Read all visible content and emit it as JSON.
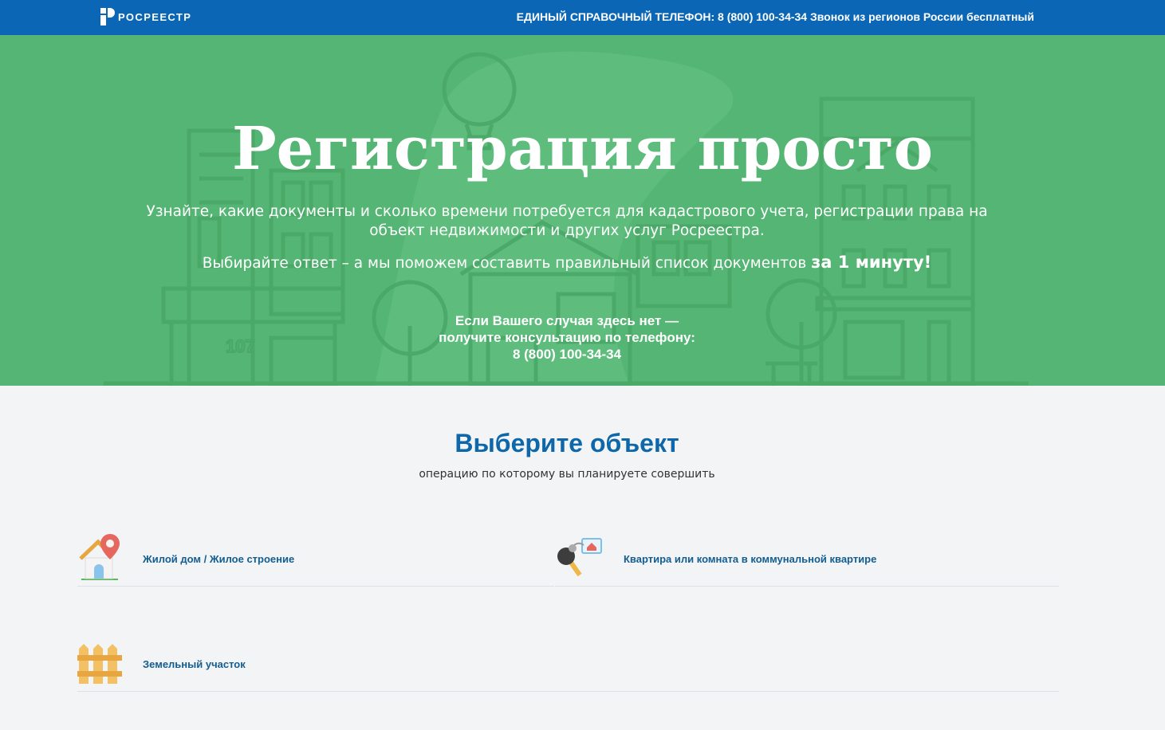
{
  "header": {
    "logo_text": "РОСРЕЕСТР",
    "phone_line": "ЕДИНЫЙ СПРАВОЧНЫЙ ТЕЛЕФОН: 8 (800) 100-34-34 Звонок из регионов России бесплатный"
  },
  "hero": {
    "title": "Регистрация просто",
    "description": "Узнайте, какие документы и сколько времени потребуется для кадастрового учета, регистрации права на объект недвижимости и других услуг Росреестра.",
    "cta_text": "Выбирайте ответ – а мы поможем составить правильный список документов ",
    "cta_bold": "за 1 минуту!",
    "building_number": "107",
    "consult_line1": "Если Вашего случая здесь нет —",
    "consult_line2": "получите консультацию по телефону:",
    "consult_phone": "8 (800) 100-34-34"
  },
  "section": {
    "title": "Выберите объект",
    "subtitle": "операцию по которому вы планируете совершить"
  },
  "options": [
    {
      "label": "Жилой дом / Жилое строение",
      "icon": "house-with-pin-icon"
    },
    {
      "label": "Квартира или комната в коммунальной квартире",
      "icon": "keys-with-tag-icon"
    },
    {
      "label": "Земельный участок",
      "icon": "fence-icon"
    }
  ],
  "colors": {
    "topbar": "#0b67b6",
    "hero": "#55b574",
    "section_title": "#0e67a9",
    "option_label": "#135d8f"
  }
}
